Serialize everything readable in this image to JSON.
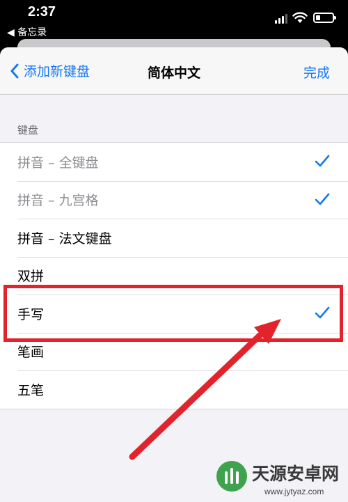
{
  "status_bar": {
    "time": "2:37",
    "back_app": "◀ 备忘录"
  },
  "navbar": {
    "back_label": "添加新键盘",
    "title": "简体中文",
    "done_label": "完成"
  },
  "section": {
    "header": "键盘"
  },
  "keyboards": [
    {
      "label": "拼音 – 全键盘",
      "checked": true,
      "disabled": true
    },
    {
      "label": "拼音 – 九宫格",
      "checked": true,
      "disabled": true
    },
    {
      "label": "拼音 – 法文键盘",
      "checked": false,
      "disabled": false
    },
    {
      "label": "双拼",
      "checked": false,
      "disabled": false
    },
    {
      "label": "手写",
      "checked": true,
      "disabled": false
    },
    {
      "label": "笔画",
      "checked": false,
      "disabled": false
    },
    {
      "label": "五笔",
      "checked": false,
      "disabled": false
    }
  ],
  "watermark": {
    "name": "天源安卓网",
    "url": "www.jytyaz.com"
  },
  "colors": {
    "accent": "#1478f0",
    "highlight": "#e3232c"
  }
}
